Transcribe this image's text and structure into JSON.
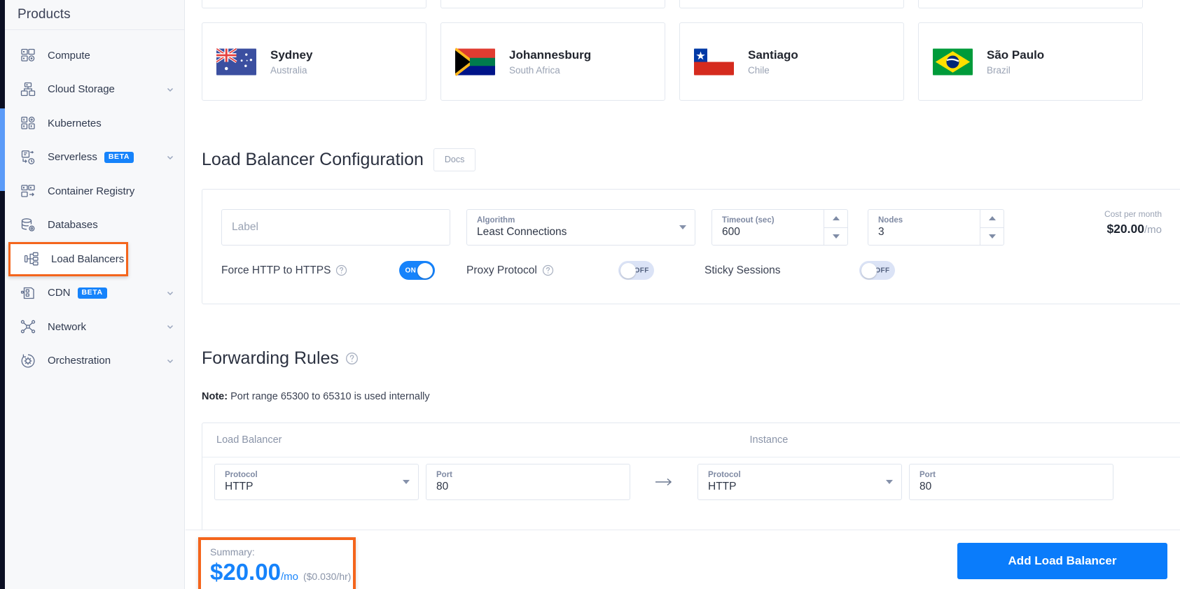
{
  "sidebar": {
    "title": "Products",
    "items": [
      {
        "label": "Compute",
        "icon": "compute-icon",
        "badge": null,
        "chevron": false
      },
      {
        "label": "Cloud Storage",
        "icon": "cloud-storage-icon",
        "badge": null,
        "chevron": true
      },
      {
        "label": "Kubernetes",
        "icon": "kubernetes-icon",
        "badge": null,
        "chevron": false
      },
      {
        "label": "Serverless",
        "icon": "serverless-icon",
        "badge": "BETA",
        "chevron": true
      },
      {
        "label": "Container Registry",
        "icon": "container-registry-icon",
        "badge": null,
        "chevron": false
      },
      {
        "label": "Databases",
        "icon": "databases-icon",
        "badge": null,
        "chevron": false
      },
      {
        "label": "Load Balancers",
        "icon": "load-balancer-icon",
        "badge": null,
        "chevron": false,
        "highlighted": true
      },
      {
        "label": "CDN",
        "icon": "cdn-icon",
        "badge": "BETA",
        "chevron": true
      },
      {
        "label": "Network",
        "icon": "network-icon",
        "badge": null,
        "chevron": true
      },
      {
        "label": "Orchestration",
        "icon": "orchestration-icon",
        "badge": null,
        "chevron": true
      }
    ]
  },
  "regions": [
    {
      "city": "Sydney",
      "country": "Australia",
      "flag": "au-flag-icon"
    },
    {
      "city": "Johannesburg",
      "country": "South Africa",
      "flag": "za-flag-icon"
    },
    {
      "city": "Santiago",
      "country": "Chile",
      "flag": "cl-flag-icon"
    },
    {
      "city": "São Paulo",
      "country": "Brazil",
      "flag": "br-flag-icon"
    }
  ],
  "config": {
    "title": "Load Balancer Configuration",
    "docs_label": "Docs",
    "label_field": {
      "placeholder": "Label",
      "value": ""
    },
    "algorithm": {
      "label": "Algorithm",
      "value": "Least Connections"
    },
    "timeout": {
      "label": "Timeout (sec)",
      "value": "600"
    },
    "nodes": {
      "label": "Nodes",
      "value": "3"
    },
    "cost": {
      "label": "Cost per month",
      "amount": "$20.00",
      "per": "/mo"
    },
    "toggles": [
      {
        "label": "Force HTTP to HTTPS",
        "state": "ON",
        "help": true
      },
      {
        "label": "Proxy Protocol",
        "state": "OFF",
        "help": true
      },
      {
        "label": "Sticky Sessions",
        "state": "OFF",
        "help": false
      }
    ]
  },
  "forwarding": {
    "title": "Forwarding Rules",
    "note_prefix": "Note:",
    "note_text": " Port range 65300 to 65310 is used internally",
    "columns": {
      "left": "Load Balancer",
      "right": "Instance"
    },
    "rule": {
      "lb_protocol": {
        "label": "Protocol",
        "value": "HTTP"
      },
      "lb_port": {
        "label": "Port",
        "value": "80"
      },
      "inst_protocol": {
        "label": "Protocol",
        "value": "HTTP"
      },
      "inst_port": {
        "label": "Port",
        "value": "80"
      }
    }
  },
  "bottom": {
    "summary_label": "Summary:",
    "price": "$20.00",
    "per": "/mo",
    "hourly": "($0.030/hr)",
    "cta_label": "Add Load Balancer"
  },
  "colors": {
    "accent_blue": "#1683fb",
    "cta_blue": "#0a7cfb",
    "highlight_orange": "#f4651c",
    "sidebar_bg": "#f7f8fa",
    "rail_dark": "#0b0f23",
    "scroll_thumb": "#5b9bf8"
  }
}
